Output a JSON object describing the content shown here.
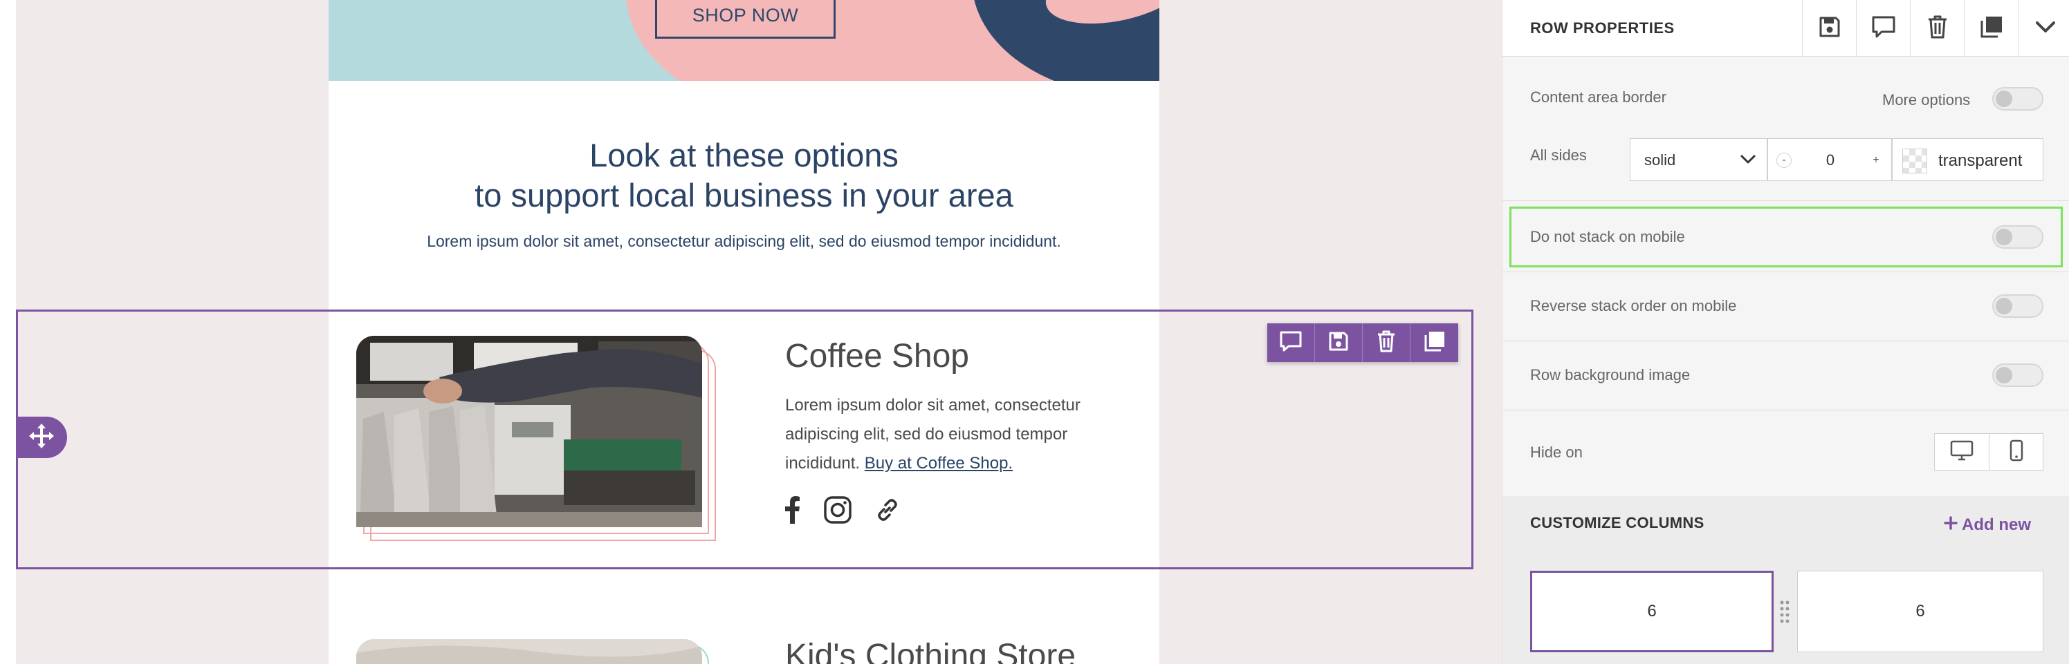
{
  "email": {
    "hero_button": "SHOP NOW",
    "headline_line1": "Look at these options",
    "headline_line2": "to support local business in your area",
    "subtext": "Lorem ipsum dolor sit amet, consectetur adipiscing elit, sed do eiusmod tempor incididunt.",
    "coffee": {
      "title": "Coffee Shop",
      "desc": "Lorem ipsum dolor sit amet, consectetur adipiscing elit, sed do eiusmod tempor incididunt.",
      "link": "Buy at Coffee Shop."
    },
    "kids": {
      "title": "Kid's Clothing Store"
    }
  },
  "row_toolbar": {
    "icons": [
      "comment-icon",
      "save-icon",
      "trash-icon",
      "duplicate-icon"
    ]
  },
  "panel": {
    "title": "ROW PROPERTIES",
    "content_area_border": "Content area border",
    "more_options": "More options",
    "all_sides": "All sides",
    "border_style": "solid",
    "border_width": "0",
    "border_color": "transparent",
    "do_not_stack": "Do not stack on mobile",
    "reverse_stack": "Reverse stack order on mobile",
    "row_bg_image": "Row background image",
    "hide_on": "Hide on",
    "customize_columns": "CUSTOMIZE COLUMNS",
    "add_new": "Add new",
    "columns": [
      "6",
      "6"
    ]
  },
  "colors": {
    "accent": "#7c53a0",
    "highlight": "#7ce35a",
    "navy": "#2b4466",
    "pink": "#f4b8b9",
    "teal": "#b5dade"
  }
}
